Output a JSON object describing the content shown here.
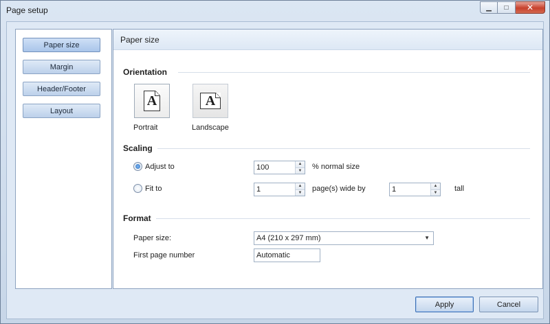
{
  "window": {
    "title": "Page setup",
    "controls": {
      "minimize": "▁",
      "maximize": "□",
      "close": "✕"
    }
  },
  "sidebar": {
    "items": [
      {
        "label": "Paper size",
        "active": true
      },
      {
        "label": "Margin"
      },
      {
        "label": "Header/Footer"
      },
      {
        "label": "Layout"
      }
    ]
  },
  "panel": {
    "title": "Paper size",
    "orientation": {
      "heading": "Orientation",
      "portrait": {
        "glyph": "A",
        "label": "Portrait",
        "selected": true
      },
      "landscape": {
        "glyph": "A",
        "label": "Landscape"
      }
    },
    "scaling": {
      "heading": "Scaling",
      "adjust_label": "Adjust to",
      "adjust_value": "100",
      "adjust_suffix": "% normal size",
      "fit_label": "Fit to",
      "fit_wide_value": "1",
      "fit_wide_suffix": "page(s) wide by",
      "fit_tall_value": "1",
      "fit_tall_suffix": "tall",
      "selected": "adjust"
    },
    "format": {
      "heading": "Format",
      "paper_size_label": "Paper size:",
      "paper_size_value": "A4 (210 x 297 mm)",
      "first_page_label": "First page number",
      "first_page_value": "Automatic"
    }
  },
  "footer": {
    "apply_label": "Apply",
    "cancel_label": "Cancel"
  },
  "icons": {
    "spin_up": "▲",
    "spin_down": "▼",
    "dropdown": "▼"
  },
  "colors": {
    "accent": "#2f72c4",
    "window_bg": "#dfe9f5"
  }
}
